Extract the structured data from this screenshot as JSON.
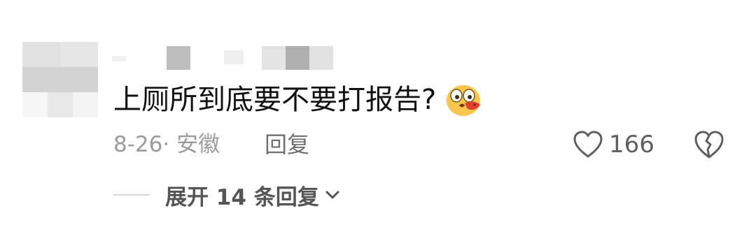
{
  "comment": {
    "avatar_icon": "blurred-avatar",
    "username_icon": "blurred-username",
    "text": "上厕所到底要不要打报告?",
    "emoji_icon": "hushed-face-with-speech-emoji",
    "date_location": "8-26· 安徽",
    "reply_label": "回复",
    "like_icon": "heart-outline-icon",
    "like_count": "166",
    "dislike_icon": "broken-heart-outline-icon",
    "expand_label": "展开 14 条回复",
    "expand_icon": "chevron-down-icon"
  },
  "colors": {
    "text_primary": "#111111",
    "text_secondary": "#9b9b9b",
    "action": "#5f5f5f",
    "emoji_yellow": "#f7c64b",
    "emoji_red": "#e0402f"
  }
}
